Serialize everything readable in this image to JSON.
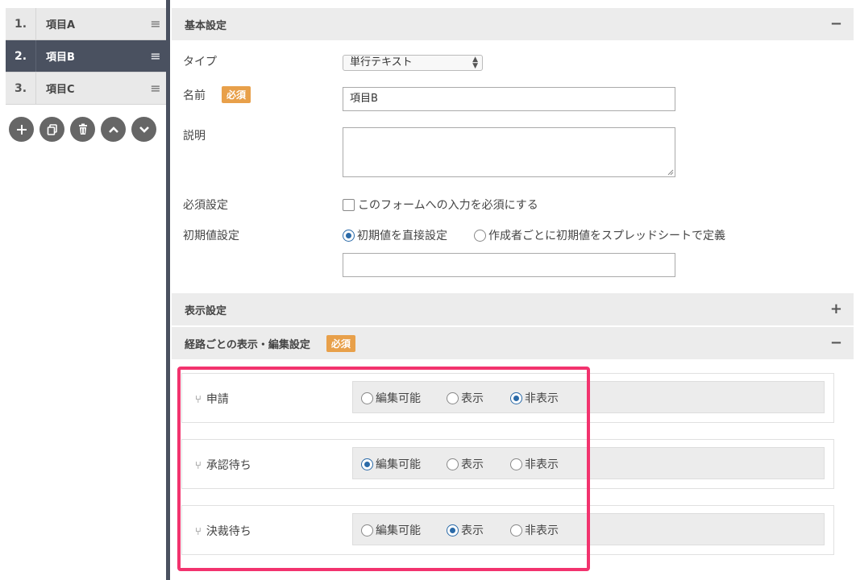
{
  "sidebar": {
    "items": [
      {
        "num": "1.",
        "label": "項目A",
        "handle": "≡"
      },
      {
        "num": "2.",
        "label": "項目B",
        "handle": "≡"
      },
      {
        "num": "3.",
        "label": "項目C",
        "handle": "≡"
      }
    ],
    "actions": [
      {
        "icon": "plus-icon",
        "glyph": "+"
      },
      {
        "icon": "copy-icon",
        "glyph": "⧉"
      },
      {
        "icon": "trash-icon",
        "glyph": "🗑"
      },
      {
        "icon": "chevron-up-icon",
        "glyph": "︿"
      },
      {
        "icon": "chevron-down-icon",
        "glyph": "﹀"
      }
    ]
  },
  "basic": {
    "title": "基本設定",
    "toggle": "−",
    "type_label": "タイプ",
    "type_value": "単行テキスト",
    "name_label": "名前",
    "required_badge": "必須",
    "name_value": "項目B",
    "desc_label": "説明",
    "required_setting_label": "必須設定",
    "required_checkbox_text": "このフォームへの入力を必須にする",
    "default_label": "初期値設定",
    "default_opt1": "初期値を直接設定",
    "default_opt2": "作成者ごとに初期値をスプレッドシートで定義"
  },
  "display": {
    "title": "表示設定",
    "toggle": "+"
  },
  "route": {
    "title": "経路ごとの表示・編集設定",
    "badge": "必須",
    "toggle": "−",
    "options": [
      "編集可能",
      "表示",
      "非表示"
    ],
    "rows": [
      {
        "label": "申請",
        "selected": 2
      },
      {
        "label": "承認待ち",
        "selected": 0
      },
      {
        "label": "決裁待ち",
        "selected": 1
      }
    ]
  }
}
